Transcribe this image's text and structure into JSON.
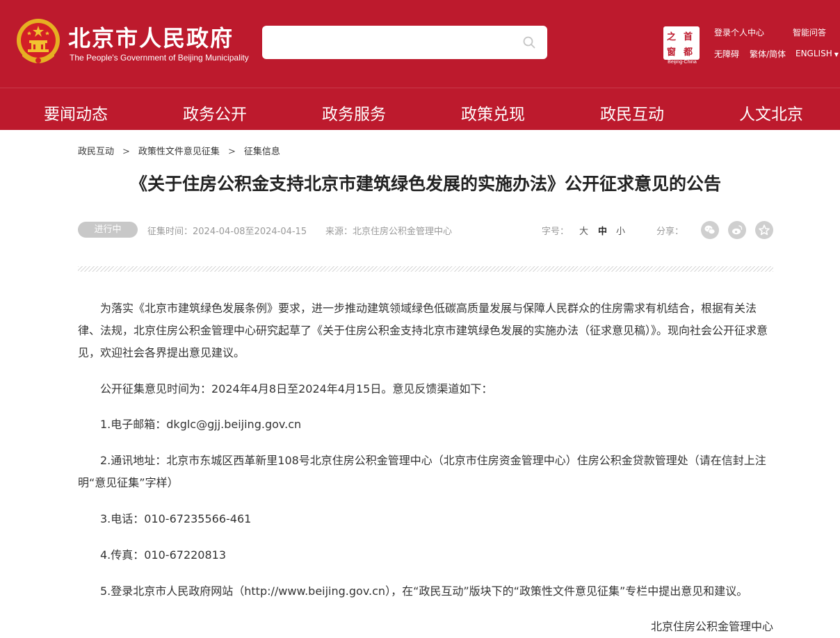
{
  "header": {
    "title": "北京市人民政府",
    "subtitle": "The People's Government of Beijing Municipality",
    "search_placeholder": "",
    "capital_logo": {
      "chars": [
        "之",
        "首",
        "窗",
        "都"
      ],
      "caption": "Beijing-China"
    },
    "links": {
      "personal_center": "登录个人中心",
      "smart_qa": "智能问答",
      "accessibility": "无障碍",
      "traditional_simple": "繁体/简体",
      "english": "ENGLISH"
    },
    "colors": {
      "brand_red": "#bd1a2d"
    }
  },
  "nav": {
    "items": [
      "要闻动态",
      "政务公开",
      "政务服务",
      "政策兑现",
      "政民互动",
      "人文北京"
    ]
  },
  "breadcrumb": {
    "items": [
      "政民互动",
      "政策性文件意见征集",
      "征集信息"
    ],
    "separator": ">"
  },
  "article": {
    "title": "《关于住房公积金支持北京市建筑绿色发展的实施办法》公开征求意见的公告",
    "status": "进行中",
    "period": "征集时间：2024-04-08至2024-04-15",
    "source": "来源：北京住房公积金管理中心",
    "font_size_label": "字号：",
    "font_sizes": [
      "大",
      "中",
      "小"
    ],
    "share_label": "分享：",
    "share_icons": [
      "wechat-icon",
      "weibo-icon",
      "favorite-star-icon"
    ],
    "paragraphs": [
      "为落实《北京市建筑绿色发展条例》要求，进一步推动建筑领域绿色低碳高质量发展与保障人民群众的住房需求有机结合，根据有关法律、法规，北京住房公积金管理中心研究起草了《关于住房公积金支持北京市建筑绿色发展的实施办法（征求意见稿）》。现向社会公开征求意见，欢迎社会各界提出意见建议。",
      "公开征集意见时间为：2024年4月8日至2024年4月15日。意见反馈渠道如下：",
      "1.电子邮箱：dkglc@gjj.beijing.gov.cn",
      "2.通讯地址：北京市东城区西革新里108号北京住房公积金管理中心（北京市住房资金管理中心）住房公积金贷款管理处（请在信封上注明“意见征集”字样）",
      "3.电话：010-67235566-461",
      "4.传真：010-67220813",
      "5.登录北京市人民政府网站（http://www.beijing.gov.cn），在“政民互动”版块下的“政策性文件意见征集”专栏中提出意见和建议。"
    ],
    "signature": "北京住房公积金管理中心"
  }
}
